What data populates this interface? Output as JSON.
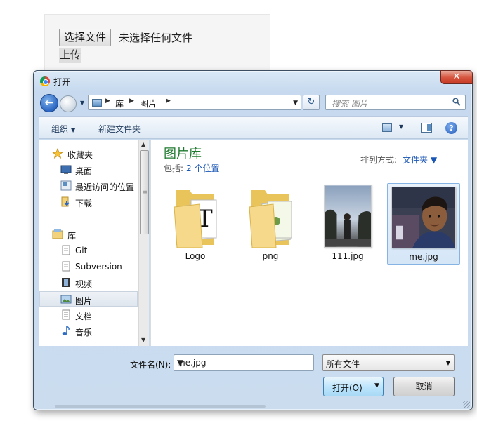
{
  "webpage": {
    "choose_button": "选择文件",
    "no_file_text": "未选择任何文件",
    "upload_button": "上传"
  },
  "dialog": {
    "title": "打开",
    "close_symbol": "✕",
    "address": {
      "crumbs": [
        "库",
        "图片"
      ],
      "search_placeholder": "搜索 图片"
    },
    "toolbar": {
      "organize": "组织",
      "new_folder": "新建文件夹"
    },
    "nav_pane": {
      "items": [
        {
          "label": "收藏夹",
          "icon": "star-icon"
        },
        {
          "label": "桌面",
          "icon": "desktop-icon"
        },
        {
          "label": "最近访问的位置",
          "icon": "recent-places-icon"
        },
        {
          "label": "下载",
          "icon": "download-folder-icon"
        },
        {
          "label": "库",
          "icon": "library-icon"
        },
        {
          "label": "Git",
          "icon": "document-icon"
        },
        {
          "label": "Subversion",
          "icon": "document-icon"
        },
        {
          "label": "视频",
          "icon": "video-icon"
        },
        {
          "label": "图片",
          "icon": "pictures-icon"
        },
        {
          "label": "文档",
          "icon": "documents-icon"
        },
        {
          "label": "音乐",
          "icon": "music-icon"
        }
      ],
      "selected": "图片"
    },
    "content": {
      "library_title": "图片库",
      "includes_label": "包括:",
      "includes_link": "2 个位置",
      "arrange_label": "排列方式:",
      "arrange_value": "文件夹",
      "files": [
        {
          "name": "Logo",
          "type": "folder"
        },
        {
          "name": "png",
          "type": "folder"
        },
        {
          "name": "111.jpg",
          "type": "image"
        },
        {
          "name": "me.jpg",
          "type": "image",
          "selected": true
        }
      ]
    },
    "footer": {
      "filename_label": "文件名(N):",
      "filename_value": "me.jpg",
      "filter_value": "所有文件",
      "open_button": "打开(O)",
      "cancel_button": "取消"
    }
  }
}
